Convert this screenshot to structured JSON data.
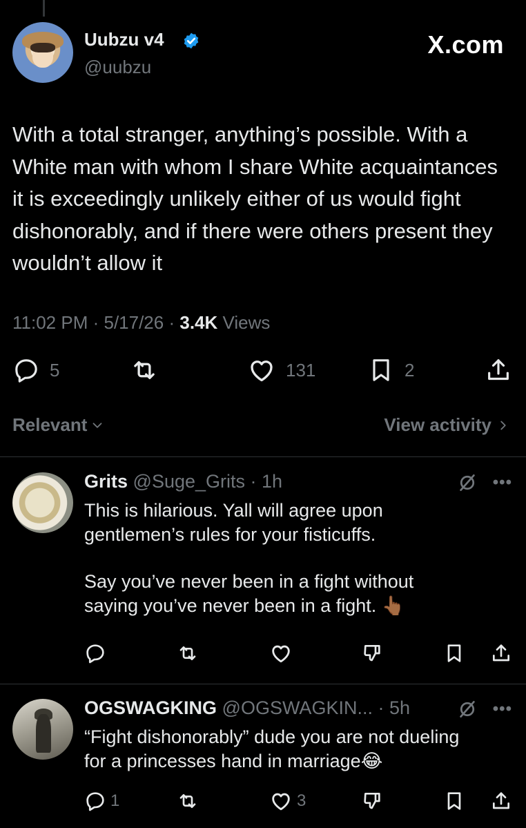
{
  "main_tweet": {
    "author_name": "Uubzu v4",
    "author_handle": "@uubzu",
    "brand": "X.com",
    "text": "With a total stranger, anything’s possible. With a White man with whom I share White acquaintances it is exceedingly unlikely either of us would fight dishonorably, and if there were others present they wouldn’t allow it",
    "time": "11:02 PM",
    "date": "5/17/26",
    "views_count": "3.4K",
    "views_label": "Views",
    "actions": {
      "replies": "5",
      "likes": "131",
      "bookmarks": "2"
    }
  },
  "sort": {
    "label": "Relevant",
    "view_activity": "View activity"
  },
  "replies": [
    {
      "author_name": "Grits",
      "author_handle": "@Suge_Grits",
      "time": "1h",
      "text_lines": [
        "This is hilarious. Yall will agree upon",
        "gentlemen’s rules for your fisticuffs."
      ],
      "text_lines_2": [
        "Say you’ve never been in a fight without",
        "saying you’ve never been in a fight. 👆🏾"
      ],
      "reply_count": "",
      "like_count": ""
    },
    {
      "author_name": "OGSWAGKING",
      "author_handle": "@OGSWAGKIN...",
      "time": "5h",
      "text_lines": [
        "“Fight dishonorably” dude you are not dueling",
        "for a princesses hand in marriage😂"
      ],
      "reply_count": "1",
      "like_count": "3"
    }
  ],
  "colors": {
    "background": "#000000",
    "text": "#e7e9ea",
    "muted": "#71767b",
    "divider": "#2f3336",
    "verified": "#1d9bf0"
  },
  "icons": [
    "verified-badge-icon",
    "reply-icon",
    "repost-icon",
    "like-icon",
    "bookmark-icon",
    "share-icon",
    "chevron-down-icon",
    "chevron-right-icon",
    "grok-slash-icon",
    "more-dots-icon",
    "dislike-icon"
  ]
}
